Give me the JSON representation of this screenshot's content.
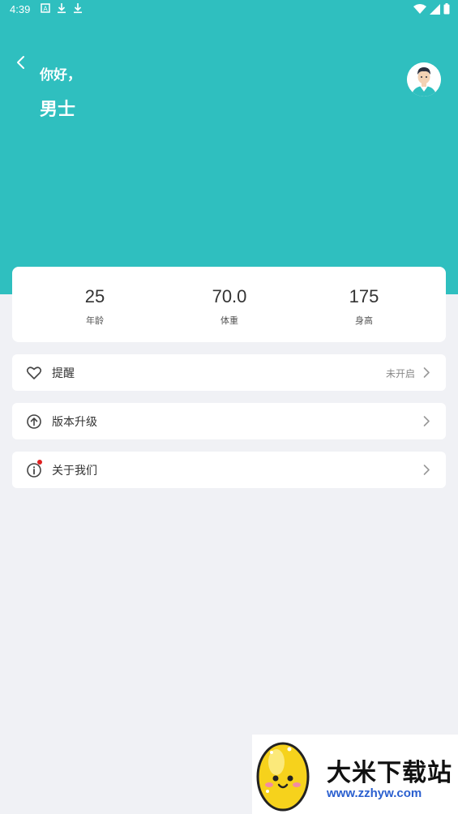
{
  "status_bar": {
    "time": "4:39",
    "icons": [
      "a-icon",
      "download-icon",
      "download-icon"
    ],
    "right_icons": [
      "wifi-icon",
      "signal-icon",
      "battery-icon"
    ]
  },
  "header": {
    "greeting": "你好，",
    "username": "男士",
    "bg_color": "#2fbfbf"
  },
  "stats": [
    {
      "value": "25",
      "label": "年龄"
    },
    {
      "value": "70.0",
      "label": "体重"
    },
    {
      "value": "175",
      "label": "身高"
    }
  ],
  "menu": [
    {
      "icon": "heart-icon",
      "label": "提醒",
      "value": "未开启"
    },
    {
      "icon": "upgrade-arrow-icon",
      "label": "版本升级",
      "value": ""
    },
    {
      "icon": "info-icon",
      "label": "关于我们",
      "value": "",
      "badge": true
    }
  ],
  "watermark": {
    "title": "大米下载站",
    "url": "www.zzhyw.com"
  }
}
